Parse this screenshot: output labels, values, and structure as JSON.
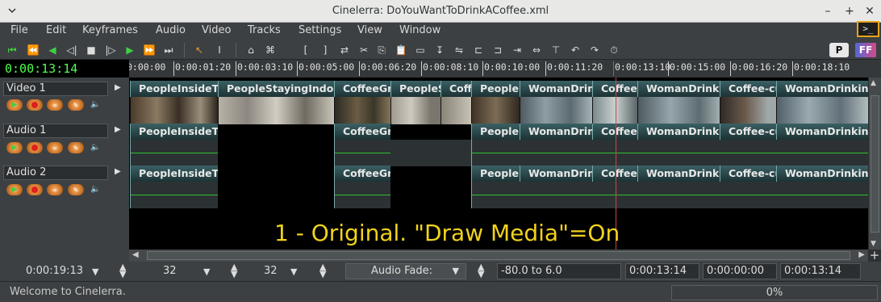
{
  "window": {
    "title": "Cinelerra: DoYouWantToDrinkACoffee.xml"
  },
  "menu": [
    "File",
    "Edit",
    "Keyframes",
    "Audio",
    "Video",
    "Tracks",
    "Settings",
    "View",
    "Window"
  ],
  "toolbar": {
    "format_label": "P"
  },
  "clock": "0:00:13:14",
  "ruler": [
    "0:00:00",
    "0:00:01:20",
    "0:00:03:10",
    "0:00:05:00",
    "0:00:06:20",
    "0:00:08:10",
    "0:00:10:00",
    "0:00:11:20",
    "0:00:13:10",
    "0:00:15:00",
    "0:00:16:20",
    "0:00:18:10"
  ],
  "tracks": [
    {
      "name": "Video 1",
      "type": "video"
    },
    {
      "name": "Audio 1",
      "type": "audio"
    },
    {
      "name": "Audio 2",
      "type": "audio"
    }
  ],
  "video_edits": [
    "PeopleInsideTheCafeteria",
    "PeopleStayingIndoors",
    "CoffeeGrinder",
    "PeopleSittingInside",
    "CoffeeMachine",
    "PeopleInside",
    "WomanDrinkingCoffee",
    "CoffeeCup",
    "WomanDrinkingCoffee",
    "Coffee-cup",
    "WomanDrinking"
  ],
  "audio_edits": [
    "PeopleInsideTheCafeteria",
    "CoffeeGrinder",
    "PeopleInside",
    "WomanDrinkingCoffee",
    "CoffeeCup",
    "WomanDrinkingCoffee",
    "Coffee-cup",
    "WomanDrinking"
  ],
  "overlay_text": "1 - Original. \"Draw Media\"=On",
  "status": {
    "duration": "0:00:19:13",
    "sample_zoom": "32",
    "amp_zoom": "32",
    "audio_fade_label": "Audio Fade:",
    "fade_range": "-80.0 to 6.0",
    "cursor_pos": "0:00:13:14",
    "in_point": "0:00:00:00",
    "out_point": "0:00:13:14"
  },
  "bottom": {
    "message": "Welcome to Cinelerra.",
    "progress": "0%"
  }
}
